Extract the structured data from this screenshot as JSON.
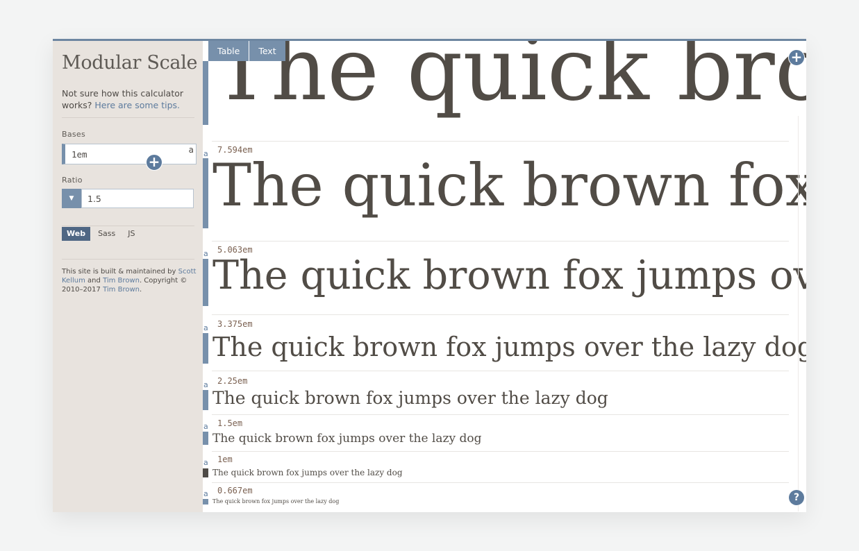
{
  "sidebar": {
    "title": "Modular Scale",
    "intro_text": "Not sure how this calculator works?",
    "intro_link": "Here are some tips.",
    "bases_label": "Bases",
    "bases_value": "1em",
    "bases_marker": "a",
    "ratio_label": "Ratio",
    "ratio_value": "1.5",
    "code_tabs": [
      {
        "label": "Web",
        "active": true
      },
      {
        "label": "Sass",
        "active": false
      },
      {
        "label": "JS",
        "active": false
      }
    ],
    "credits": {
      "prefix": "This site is built & maintained by",
      "author1": "Scott Kellum",
      "and": "and",
      "author2": "Tim Brown",
      "copyright": ". Copyright © 2010–2017",
      "author3": "Tim Brown",
      "suffix": "."
    }
  },
  "main": {
    "view_tabs": [
      {
        "label": "Table"
      },
      {
        "label": "Text"
      }
    ],
    "add_icon": "plus-circle-icon",
    "help_icon": "question-mark-icon",
    "help_glyph": "?",
    "marker": "a",
    "sample_text": "The quick brown fox jumps over the lazy dog",
    "steps": [
      {
        "size": "",
        "active": false
      },
      {
        "size": "7.594em",
        "active": false
      },
      {
        "size": "5.063em",
        "active": false
      },
      {
        "size": "3.375em",
        "active": false
      },
      {
        "size": "2.25em",
        "active": false
      },
      {
        "size": "1.5em",
        "active": false
      },
      {
        "size": "1em",
        "active": true
      },
      {
        "size": "0.667em",
        "active": false
      }
    ]
  },
  "colors": {
    "accent": "#7790ab",
    "accent_dark": "#5d7b9d",
    "active_base_bar": "#4e4a46",
    "sidebar_bg": "#e8e3de",
    "sample_text": "#514c46",
    "size_label": "#7a6050"
  }
}
